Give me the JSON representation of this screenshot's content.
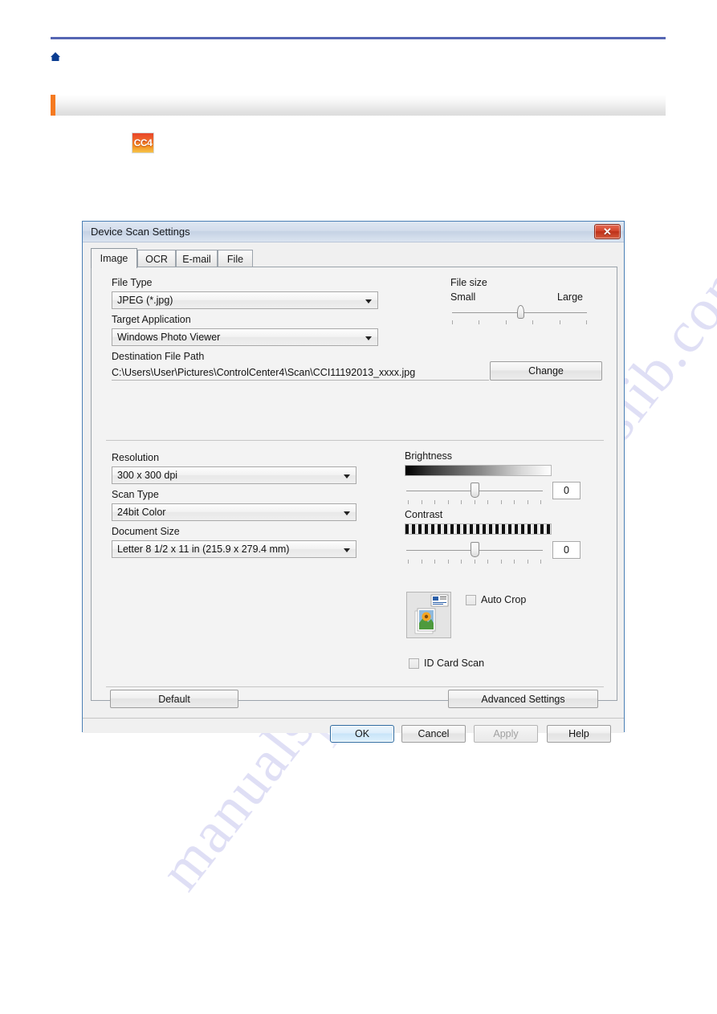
{
  "page": {
    "home_icon": "home-icon",
    "app_icon_label": "CC4",
    "watermark": "manualslib.com"
  },
  "dialog": {
    "title": "Device Scan Settings",
    "close_label": "✕",
    "tabs": [
      {
        "label": "Image",
        "active": true
      },
      {
        "label": "OCR",
        "active": false
      },
      {
        "label": "E-mail",
        "active": false
      },
      {
        "label": "File",
        "active": false
      }
    ],
    "file_type": {
      "label": "File Type",
      "value": "JPEG (*.jpg)"
    },
    "target_application": {
      "label": "Target Application",
      "value": "Windows Photo Viewer"
    },
    "destination_file_path": {
      "label": "Destination File Path",
      "value": "C:\\Users\\User\\Pictures\\ControlCenter4\\Scan\\CCI11192013_xxxx.jpg",
      "change_button": "Change"
    },
    "file_size": {
      "label": "File size",
      "min_label": "Small",
      "max_label": "Large",
      "value_percent": 52
    },
    "resolution": {
      "label": "Resolution",
      "value": "300 x 300 dpi"
    },
    "scan_type": {
      "label": "Scan Type",
      "value": "24bit Color"
    },
    "document_size": {
      "label": "Document Size",
      "value": "Letter 8 1/2 x 11 in (215.9 x 279.4 mm)"
    },
    "brightness": {
      "label": "Brightness",
      "value": "0",
      "value_percent": 50
    },
    "contrast": {
      "label": "Contrast",
      "value": "0",
      "value_percent": 50
    },
    "auto_crop": {
      "label": "Auto Crop",
      "checked": false
    },
    "id_card_scan": {
      "label": "ID Card Scan",
      "checked": false
    },
    "buttons": {
      "default": "Default",
      "advanced_settings": "Advanced Settings",
      "ok": "OK",
      "cancel": "Cancel",
      "apply": "Apply",
      "help": "Help"
    }
  }
}
